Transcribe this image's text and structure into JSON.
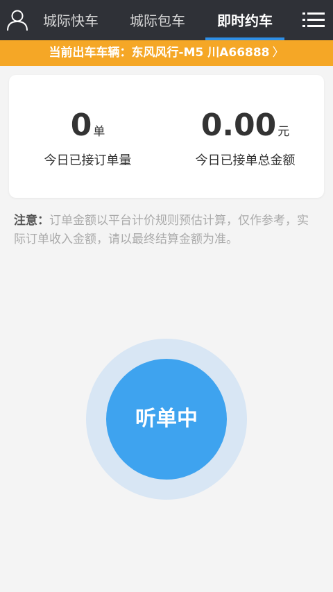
{
  "header": {
    "tabs": [
      {
        "label": "城际快车",
        "active": false
      },
      {
        "label": "城际包车",
        "active": false
      },
      {
        "label": "即时约车",
        "active": true
      }
    ],
    "left_icon": "user-icon",
    "right_icon": "menu-list-icon"
  },
  "vehicle_bar": {
    "text": "当前出车车辆：东风风行-M5 川A66888",
    "chevron": "〉"
  },
  "stats": {
    "orders_value": "0",
    "orders_unit": "单",
    "orders_label": "今日已接订单量",
    "amount_value": "0.00",
    "amount_unit": "元",
    "amount_label": "今日已接单总金额"
  },
  "notice": {
    "label": "注意：",
    "text": "订单金额以平台计价规则预估计算，仅作参考，实际订单收入金额，请以最终结算金额为准。"
  },
  "listen_button": {
    "label": "听单中"
  },
  "colors": {
    "header_bg": "#2f3137",
    "accent_blue": "#2f8fe6",
    "vehicle_bar_bg": "#f5a726",
    "button_blue": "#3ea3ef",
    "button_halo": "#d8e6f4"
  }
}
